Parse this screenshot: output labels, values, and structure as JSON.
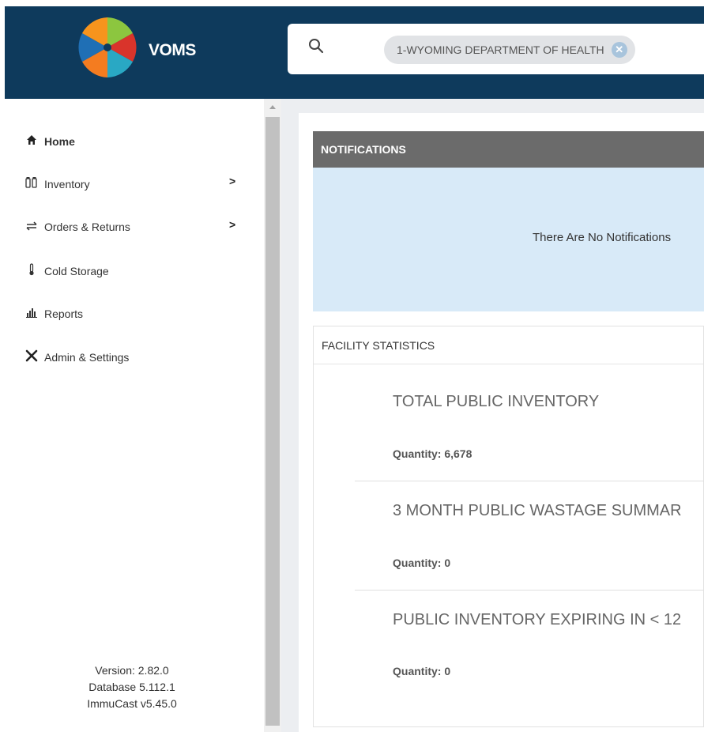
{
  "app": {
    "brand": "VOMS"
  },
  "search": {
    "icon": "search-icon",
    "chip_label": "1-WYOMING DEPARTMENT OF HEALTH"
  },
  "sidebar": {
    "items": [
      {
        "label": "Home",
        "icon": "home-icon",
        "has_submenu": false
      },
      {
        "label": "Inventory",
        "icon": "vials-icon",
        "has_submenu": true
      },
      {
        "label": "Orders & Returns",
        "icon": "exchange-icon",
        "has_submenu": true
      },
      {
        "label": "Cold Storage",
        "icon": "thermometer-icon",
        "has_submenu": false
      },
      {
        "label": "Reports",
        "icon": "bar-chart-icon",
        "has_submenu": false
      },
      {
        "label": "Admin & Settings",
        "icon": "tools-icon",
        "has_submenu": false
      }
    ],
    "version": "Version: 2.82.0",
    "database": "Database 5.112.1",
    "immucast": "ImmuCast v5.45.0"
  },
  "notifications": {
    "title": "NOTIFICATIONS",
    "empty_message": "There Are No Notifications"
  },
  "facility_statistics": {
    "title": "FACILITY STATISTICS",
    "items": [
      {
        "title": "TOTAL PUBLIC INVENTORY",
        "quantity": "Quantity: 6,678"
      },
      {
        "title": "3 MONTH PUBLIC WASTAGE SUMMAR",
        "quantity": "Quantity: 0"
      },
      {
        "title": "PUBLIC INVENTORY EXPIRING IN < 12",
        "quantity": "Quantity: 0"
      }
    ]
  },
  "colors": {
    "header_bg": "#0e3a5c",
    "notif_header_bg": "#6b6b6b",
    "notif_body_bg": "#d8eaf8"
  }
}
